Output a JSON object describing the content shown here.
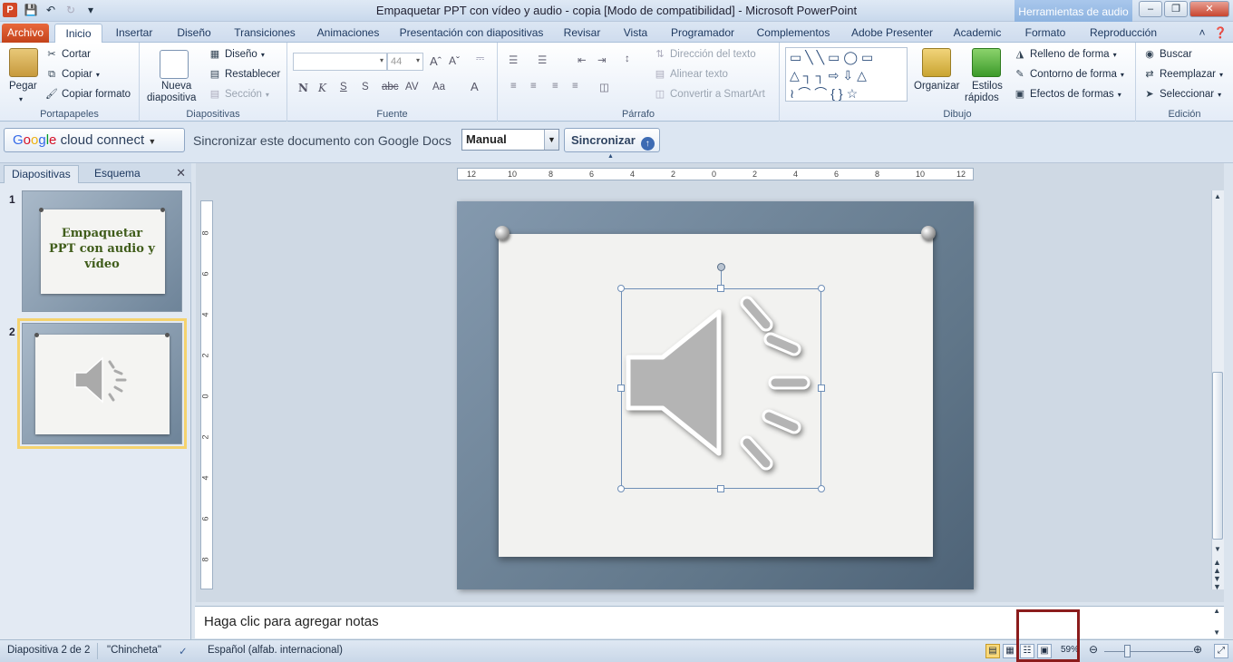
{
  "title": "Empaquetar PPT con vídeo y audio - copia [Modo de compatibilidad]  -  Microsoft PowerPoint",
  "context_tab_header": "Herramientas de audio",
  "tabs": [
    "Archivo",
    "Inicio",
    "Insertar",
    "Diseño",
    "Transiciones",
    "Animaciones",
    "Presentación con diapositivas",
    "Revisar",
    "Vista",
    "Programador",
    "Complementos",
    "Adobe Presenter",
    "Academic",
    "Formato",
    "Reproducción"
  ],
  "ribbon": {
    "portapapeles": {
      "label": "Portapapeles",
      "pegar": "Pegar",
      "cortar": "Cortar",
      "copiar": "Copiar",
      "copiar_formato": "Copiar formato"
    },
    "diapositivas": {
      "label": "Diapositivas",
      "nueva": "Nueva",
      "nueva2": "diapositiva",
      "diseno": "Diseño",
      "restablecer": "Restablecer",
      "seccion": "Sección"
    },
    "fuente": {
      "label": "Fuente",
      "size": "44"
    },
    "parrafo": {
      "label": "Párrafo",
      "direccion": "Dirección del texto",
      "alinear": "Alinear texto",
      "smartart": "Convertir a SmartArt"
    },
    "dibujo": {
      "label": "Dibujo",
      "organizar": "Organizar",
      "estilos": "Estilos",
      "estilos2": "rápidos",
      "relleno": "Relleno de forma",
      "contorno": "Contorno de forma",
      "efectos": "Efectos de formas"
    },
    "edicion": {
      "label": "Edición",
      "buscar": "Buscar",
      "reemplazar": "Reemplazar",
      "seleccionar": "Seleccionar"
    }
  },
  "google": {
    "brand_google": "Google",
    "brand_rest": "cloud connect",
    "sync_text": "Sincronizar este documento con Google Docs",
    "mode": "Manual",
    "sync_button": "Sincronizar"
  },
  "panel": {
    "tab_diapositivas": "Diapositivas",
    "tab_esquema": "Esquema",
    "slides": [
      {
        "num": "1",
        "title": "Empaquetar PPT con audio y vídeo"
      },
      {
        "num": "2"
      }
    ]
  },
  "ruler_h": [
    "12",
    "10",
    "8",
    "6",
    "4",
    "2",
    "0",
    "2",
    "4",
    "6",
    "8",
    "10",
    "12"
  ],
  "ruler_v": [
    "8",
    "6",
    "4",
    "2",
    "0",
    "2",
    "4",
    "6",
    "8"
  ],
  "notes_placeholder": "Haga clic para agregar notas",
  "status": {
    "slide": "Diapositiva 2 de 2",
    "theme": "\"Chincheta\"",
    "language": "Español (alfab. internacional)",
    "zoom": "59%"
  },
  "colors": {
    "file_tab": "#d24726",
    "highlight_box": "#8b1c1c",
    "selected_thumb": "#f5d36e"
  }
}
